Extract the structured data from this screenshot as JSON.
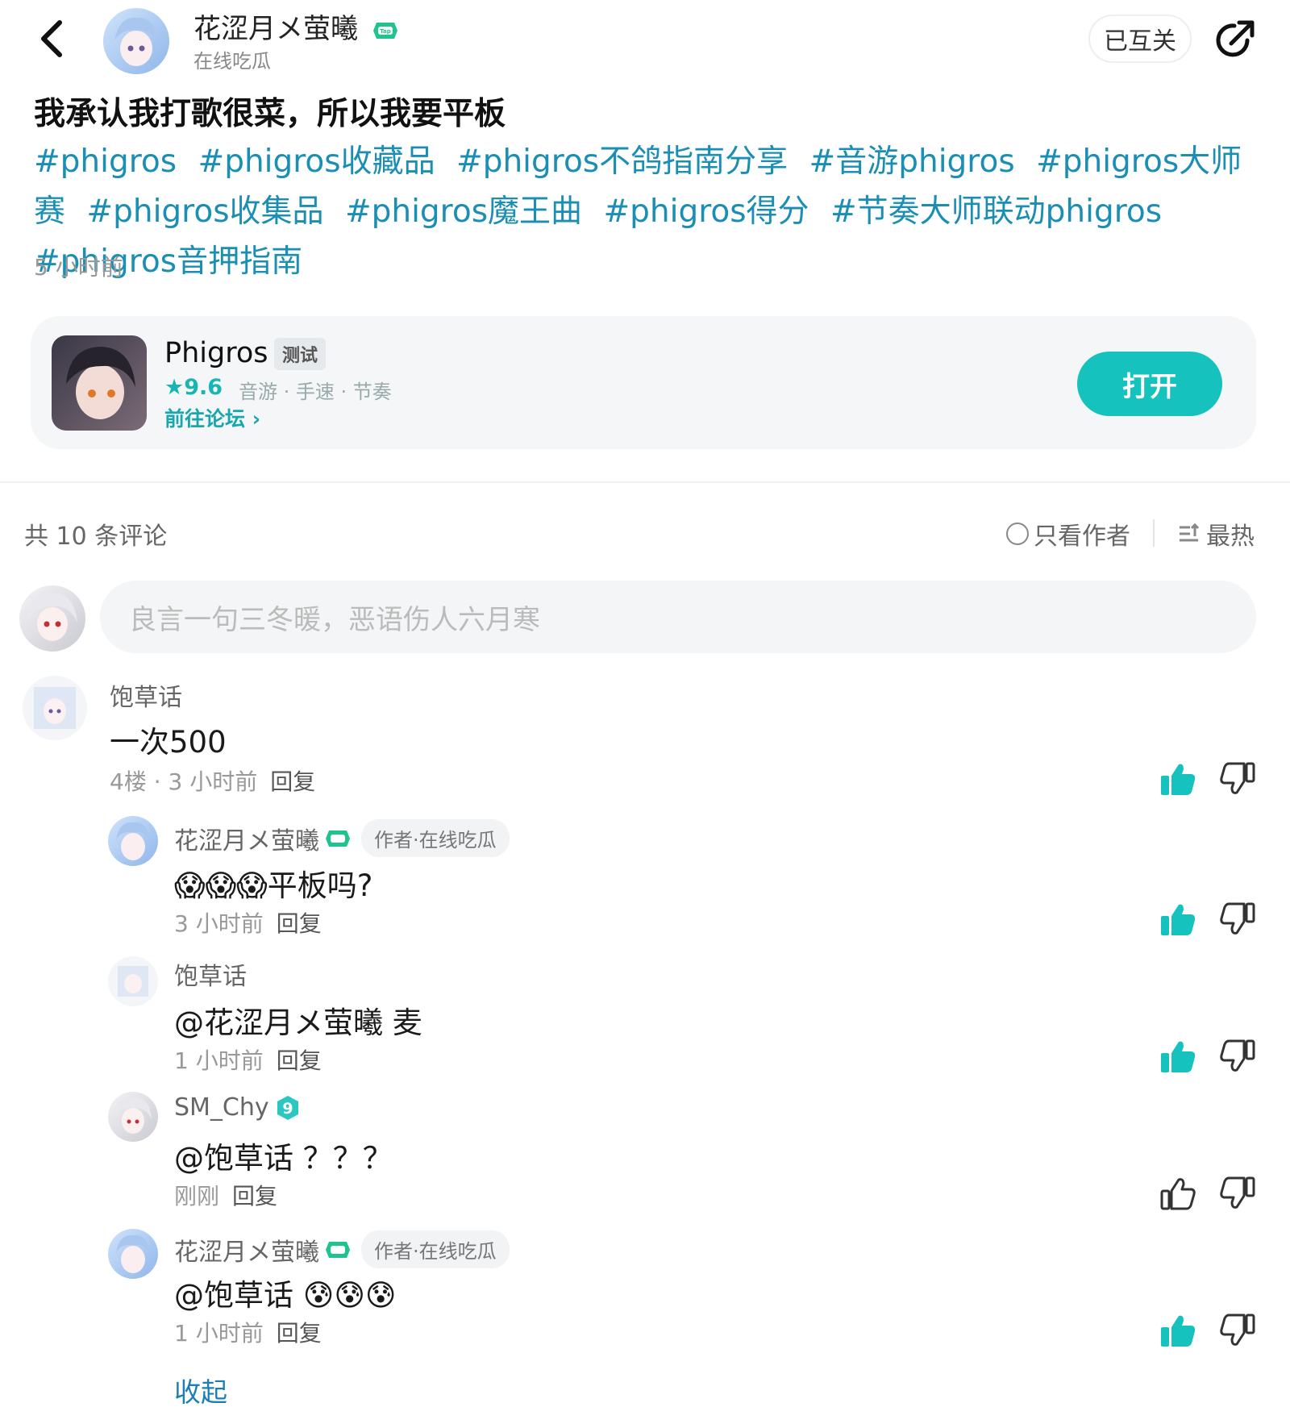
{
  "header": {
    "author_name": "花涩月メ萤曦",
    "author_status": "在线吃瓜",
    "follow_label": "已互关"
  },
  "post": {
    "title": "我承认我打歌很菜，所以我要平板",
    "tags": [
      "#phigros",
      "#phigros收藏品",
      "#phigros不鸽指南分享",
      "#音游phigros",
      "#phigros大师赛",
      "#phigros收集品",
      "#phigros魔王曲",
      "#phigros得分",
      "#节奏大师联动phigros",
      "#phigros音押指南"
    ],
    "time": "5 小时前"
  },
  "app_card": {
    "name": "Phigros",
    "badge": "测试",
    "rating": "★9.6",
    "tags": "音游 · 手速 · 节奏",
    "forum_link": "前往论坛 ›",
    "open_label": "打开"
  },
  "comments_header": {
    "count": "共 10 条评论",
    "only_author": "只看作者",
    "sort": "最热"
  },
  "compose": {
    "placeholder": "良言一句三冬暖，恶语伤人六月寒"
  },
  "comments": [
    {
      "name": "饱草话",
      "body": "一次500",
      "meta": "4楼 · 3 小时前",
      "reply": "回复",
      "liked": true
    },
    {
      "name": "花涩月メ萤曦",
      "author_tag": "作者·在线吃瓜",
      "body": "😱😱😱平板吗?",
      "meta": "3 小时前",
      "reply": "回复",
      "liked": true
    },
    {
      "name": "饱草话",
      "body": "@花涩月メ萤曦  麦",
      "meta": "1 小时前",
      "reply": "回复",
      "liked": true
    },
    {
      "name": "SM_Chy",
      "level": "9",
      "body": "@饱草话 ？？？",
      "meta": "刚刚",
      "reply": "回复",
      "liked": false
    },
    {
      "name": "花涩月メ萤曦",
      "author_tag": "作者·在线吃瓜",
      "body": "@饱草话 😰😰😰",
      "meta": "1 小时前",
      "reply": "回复",
      "liked": true
    }
  ],
  "collapse_label": "收起",
  "colors": {
    "accent": "#16c2bd",
    "link": "#1b8eb3"
  },
  "icons": [
    "back-arrow-icon",
    "share-icon",
    "tap-badge-icon",
    "star-icon",
    "circle-icon",
    "sort-icon",
    "thumb-up-icon",
    "thumb-down-icon",
    "level-badge-icon"
  ]
}
